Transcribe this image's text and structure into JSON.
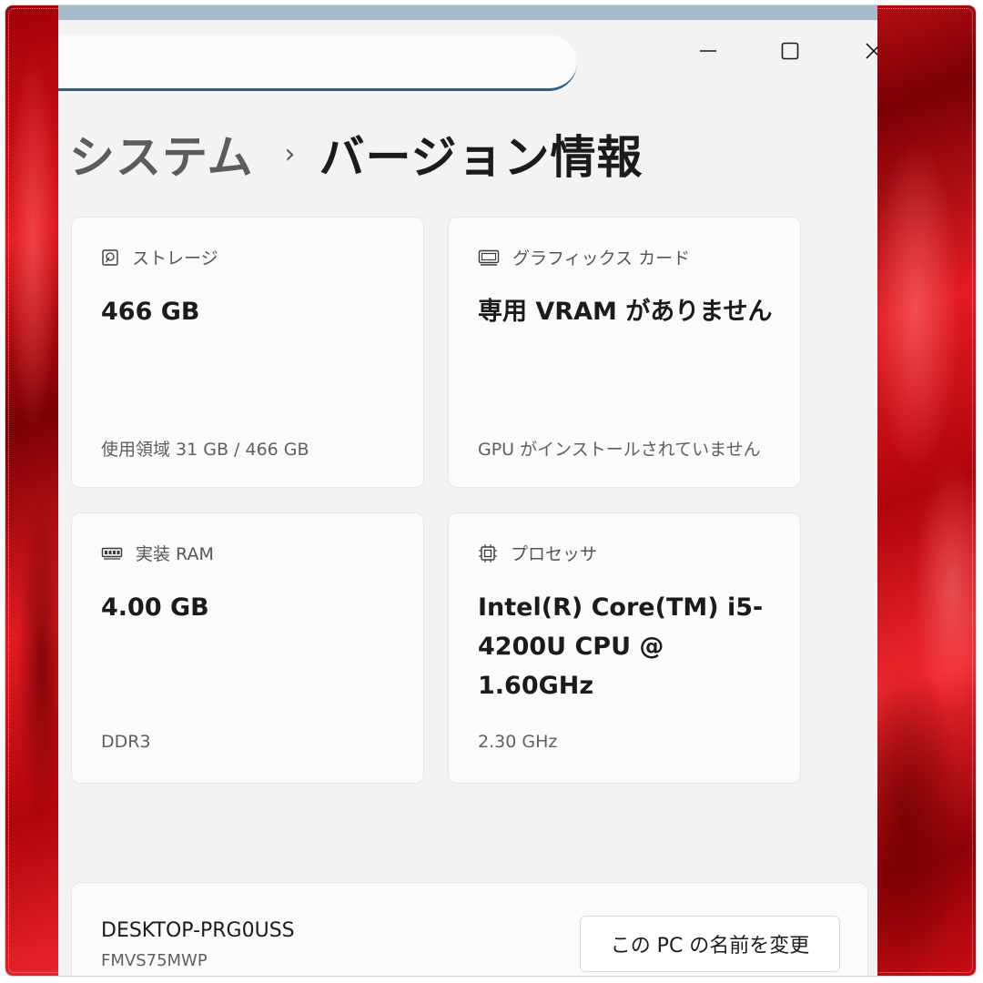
{
  "breadcrumb": {
    "parent": "システム",
    "separator": "›",
    "current": "バージョン情報"
  },
  "window_controls": {
    "minimize": "—",
    "maximize": "☐",
    "close": "✕"
  },
  "cards": {
    "storage": {
      "icon": "hard-drive-icon",
      "label": "ストレージ",
      "value": "466 GB",
      "sub": "使用領域 31 GB / 466 GB"
    },
    "graphics": {
      "icon": "display-card-icon",
      "label": "グラフィックス カード",
      "value": "専用 VRAM がありません",
      "sub": "GPU がインストールされていません"
    },
    "ram": {
      "icon": "memory-icon",
      "label": "実装 RAM",
      "value": "4.00 GB",
      "sub": "DDR3"
    },
    "processor": {
      "icon": "cpu-icon",
      "label": "プロセッサ",
      "value": "Intel(R) Core(TM) i5-4200U CPU @ 1.60GHz",
      "sub": "2.30 GHz"
    }
  },
  "device": {
    "name": "DESKTOP-PRG0USS",
    "model": "FMVS75MWP",
    "rename_button": "この PC の名前を変更"
  },
  "colors": {
    "window_bg": "#f3f3f3",
    "card_bg": "#fbfbfb",
    "search_underline": "#2a5d86",
    "background_red": "#e0161d"
  }
}
